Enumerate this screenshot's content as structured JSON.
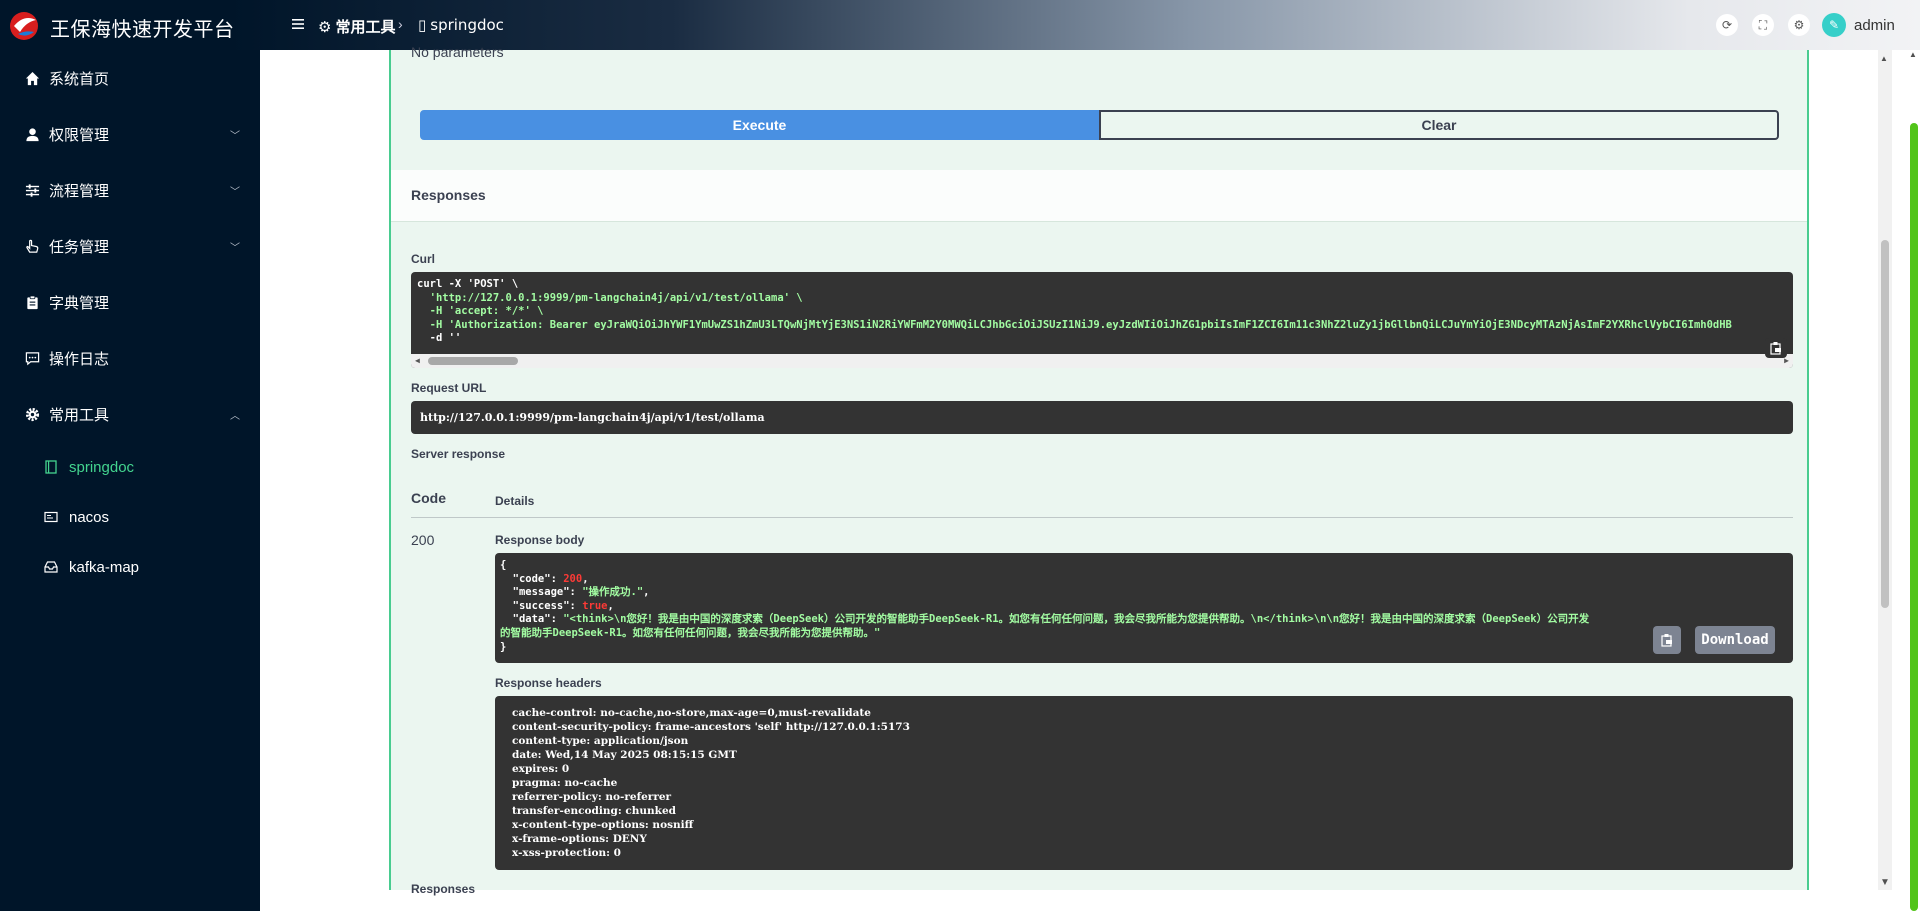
{
  "header": {
    "brand": "王保海快速开发平台",
    "breadcrumb": [
      {
        "label": "常用工具"
      },
      {
        "label": "springdoc"
      }
    ],
    "username": "admin"
  },
  "sidebar": {
    "items": [
      {
        "label": "系统首页",
        "icon": "home-icon"
      },
      {
        "label": "权限管理",
        "icon": "user-icon",
        "expandable": true
      },
      {
        "label": "流程管理",
        "icon": "sliders-icon",
        "expandable": true
      },
      {
        "label": "任务管理",
        "icon": "hand-icon",
        "expandable": true
      },
      {
        "label": "字典管理",
        "icon": "clipboard-icon"
      },
      {
        "label": "操作日志",
        "icon": "message-icon"
      },
      {
        "label": "常用工具",
        "icon": "gear-icon",
        "expanded": true
      }
    ],
    "sub_items": [
      {
        "label": "springdoc",
        "active": true
      },
      {
        "label": "nacos"
      },
      {
        "label": "kafka-map"
      }
    ]
  },
  "swagger": {
    "no_params": "No parameters",
    "execute_label": "Execute",
    "clear_label": "Clear",
    "responses_title": "Responses",
    "curl_label": "Curl",
    "curl_lines": [
      "curl -X 'POST' \\",
      "  'http://127.0.0.1:9999/pm-langchain4j/api/v1/test/ollama' \\",
      "  -H 'accept: */*' \\",
      "  -H 'Authorization: Bearer eyJraWQiOiJhYWF1YmUwZS1hZmU3LTQwNjMtYjE3NS1iN2RiYWFmM2Y0MWQiLCJhbGciOiJSUzI1NiJ9.eyJzdWIiOiJhZG1pbiIsImF1ZCI6Im11c3NhZ2luZy1jbGllbnQiLCJuYmYiOjE3NDcyMTAzNjAsImF2YXRhclVybCI6Imh0dHB",
      "  -d ''"
    ],
    "request_url_label": "Request URL",
    "request_url": "http://127.0.0.1:9999/pm-langchain4j/api/v1/test/ollama",
    "server_response_label": "Server response",
    "code_col": "Code",
    "details_col": "Details",
    "status_code": "200",
    "response_body_label": "Response body",
    "response_body": {
      "code_value": "200",
      "message_value": "\"操作成功.\"",
      "success_value": "true",
      "data_value_line1": "\"<think>\\n您好！我是由中国的深度求索（DeepSeek）公司开发的智能助手DeepSeek-R1。如您有任何任何问题，我会尽我所能为您提供帮助。\\n</think>\\n\\n您好！我是由中国的深度求索（DeepSeek）公司开发",
      "data_value_line2": "的智能助手DeepSeek-R1。如您有任何任何问题，我会尽我所能为您提供帮助。\""
    },
    "download_label": "Download",
    "response_headers_label": "Response headers",
    "response_headers": [
      "cache-control: no-cache,no-store,max-age=0,must-revalidate",
      "content-security-policy: frame-ancestors 'self' http://127.0.0.1:5173",
      "content-type: application/json",
      "date: Wed,14 May 2025 08:15:15 GMT",
      "expires: 0",
      "pragma: no-cache",
      "referrer-policy: no-referrer",
      "transfer-encoding: chunked",
      "x-content-type-options: nosniff",
      "x-frame-options: DENY",
      "x-xss-protection: 0"
    ],
    "bottom_responses": "Responses"
  },
  "colors": {
    "sidebar_bg": "#001529",
    "active_menu": "#43d48f",
    "execute_blue": "#4990e2",
    "op_green_bg": "#ebf6f0",
    "op_green_border": "#49cc90",
    "code_bg": "#333333"
  }
}
